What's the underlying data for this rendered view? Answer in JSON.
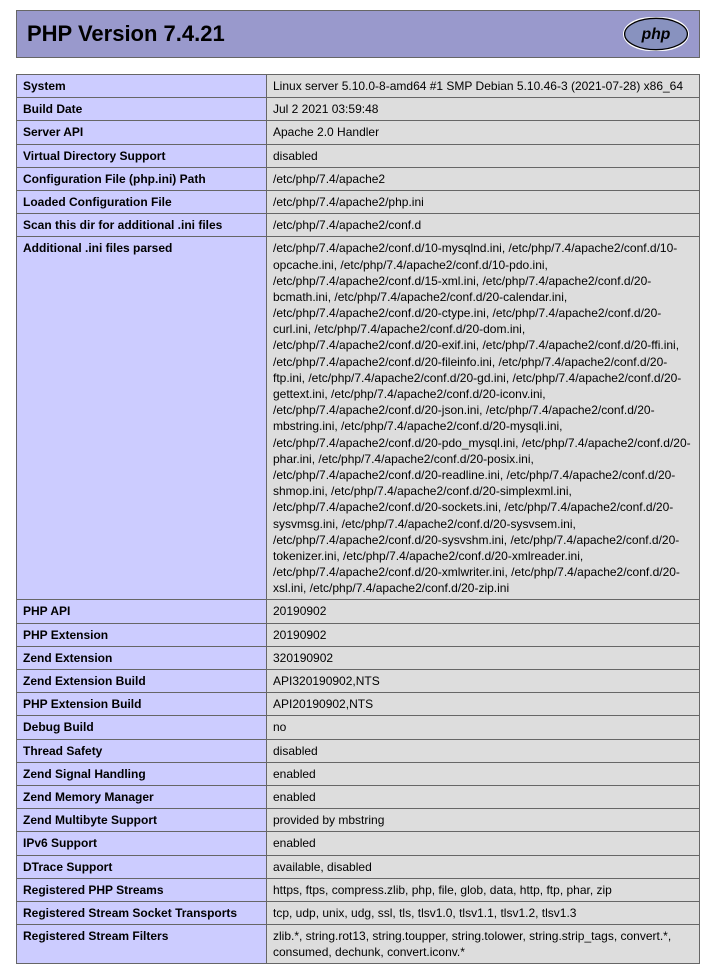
{
  "header": {
    "title": "PHP Version 7.4.21"
  },
  "rows": [
    {
      "label": "System",
      "value": "Linux server 5.10.0-8-amd64 #1 SMP Debian 5.10.46-3 (2021-07-28) x86_64"
    },
    {
      "label": "Build Date",
      "value": "Jul 2 2021 03:59:48"
    },
    {
      "label": "Server API",
      "value": "Apache 2.0 Handler"
    },
    {
      "label": "Virtual Directory Support",
      "value": "disabled"
    },
    {
      "label": "Configuration File (php.ini) Path",
      "value": "/etc/php/7.4/apache2"
    },
    {
      "label": "Loaded Configuration File",
      "value": "/etc/php/7.4/apache2/php.ini"
    },
    {
      "label": "Scan this dir for additional .ini files",
      "value": "/etc/php/7.4/apache2/conf.d"
    },
    {
      "label": "Additional .ini files parsed",
      "value": "/etc/php/7.4/apache2/conf.d/10-mysqlnd.ini, /etc/php/7.4/apache2/conf.d/10-opcache.ini, /etc/php/7.4/apache2/conf.d/10-pdo.ini, /etc/php/7.4/apache2/conf.d/15-xml.ini, /etc/php/7.4/apache2/conf.d/20-bcmath.ini, /etc/php/7.4/apache2/conf.d/20-calendar.ini, /etc/php/7.4/apache2/conf.d/20-ctype.ini, /etc/php/7.4/apache2/conf.d/20-curl.ini, /etc/php/7.4/apache2/conf.d/20-dom.ini, /etc/php/7.4/apache2/conf.d/20-exif.ini, /etc/php/7.4/apache2/conf.d/20-ffi.ini, /etc/php/7.4/apache2/conf.d/20-fileinfo.ini, /etc/php/7.4/apache2/conf.d/20-ftp.ini, /etc/php/7.4/apache2/conf.d/20-gd.ini, /etc/php/7.4/apache2/conf.d/20-gettext.ini, /etc/php/7.4/apache2/conf.d/20-iconv.ini, /etc/php/7.4/apache2/conf.d/20-json.ini, /etc/php/7.4/apache2/conf.d/20-mbstring.ini, /etc/php/7.4/apache2/conf.d/20-mysqli.ini, /etc/php/7.4/apache2/conf.d/20-pdo_mysql.ini, /etc/php/7.4/apache2/conf.d/20-phar.ini, /etc/php/7.4/apache2/conf.d/20-posix.ini, /etc/php/7.4/apache2/conf.d/20-readline.ini, /etc/php/7.4/apache2/conf.d/20-shmop.ini, /etc/php/7.4/apache2/conf.d/20-simplexml.ini, /etc/php/7.4/apache2/conf.d/20-sockets.ini, /etc/php/7.4/apache2/conf.d/20-sysvmsg.ini, /etc/php/7.4/apache2/conf.d/20-sysvsem.ini, /etc/php/7.4/apache2/conf.d/20-sysvshm.ini, /etc/php/7.4/apache2/conf.d/20-tokenizer.ini, /etc/php/7.4/apache2/conf.d/20-xmlreader.ini, /etc/php/7.4/apache2/conf.d/20-xmlwriter.ini, /etc/php/7.4/apache2/conf.d/20-xsl.ini, /etc/php/7.4/apache2/conf.d/20-zip.ini"
    },
    {
      "label": "PHP API",
      "value": "20190902"
    },
    {
      "label": "PHP Extension",
      "value": "20190902"
    },
    {
      "label": "Zend Extension",
      "value": "320190902"
    },
    {
      "label": "Zend Extension Build",
      "value": "API320190902,NTS"
    },
    {
      "label": "PHP Extension Build",
      "value": "API20190902,NTS"
    },
    {
      "label": "Debug Build",
      "value": "no"
    },
    {
      "label": "Thread Safety",
      "value": "disabled"
    },
    {
      "label": "Zend Signal Handling",
      "value": "enabled"
    },
    {
      "label": "Zend Memory Manager",
      "value": "enabled"
    },
    {
      "label": "Zend Multibyte Support",
      "value": "provided by mbstring"
    },
    {
      "label": "IPv6 Support",
      "value": "enabled"
    },
    {
      "label": "DTrace Support",
      "value": "available, disabled"
    },
    {
      "label": "Registered PHP Streams",
      "value": "https, ftps, compress.zlib, php, file, glob, data, http, ftp, phar, zip"
    },
    {
      "label": "Registered Stream Socket Transports",
      "value": "tcp, udp, unix, udg, ssl, tls, tlsv1.0, tlsv1.1, tlsv1.2, tlsv1.3"
    },
    {
      "label": "Registered Stream Filters",
      "value": "zlib.*, string.rot13, string.toupper, string.tolower, string.strip_tags, convert.*, consumed, dechunk, convert.iconv.*"
    }
  ]
}
